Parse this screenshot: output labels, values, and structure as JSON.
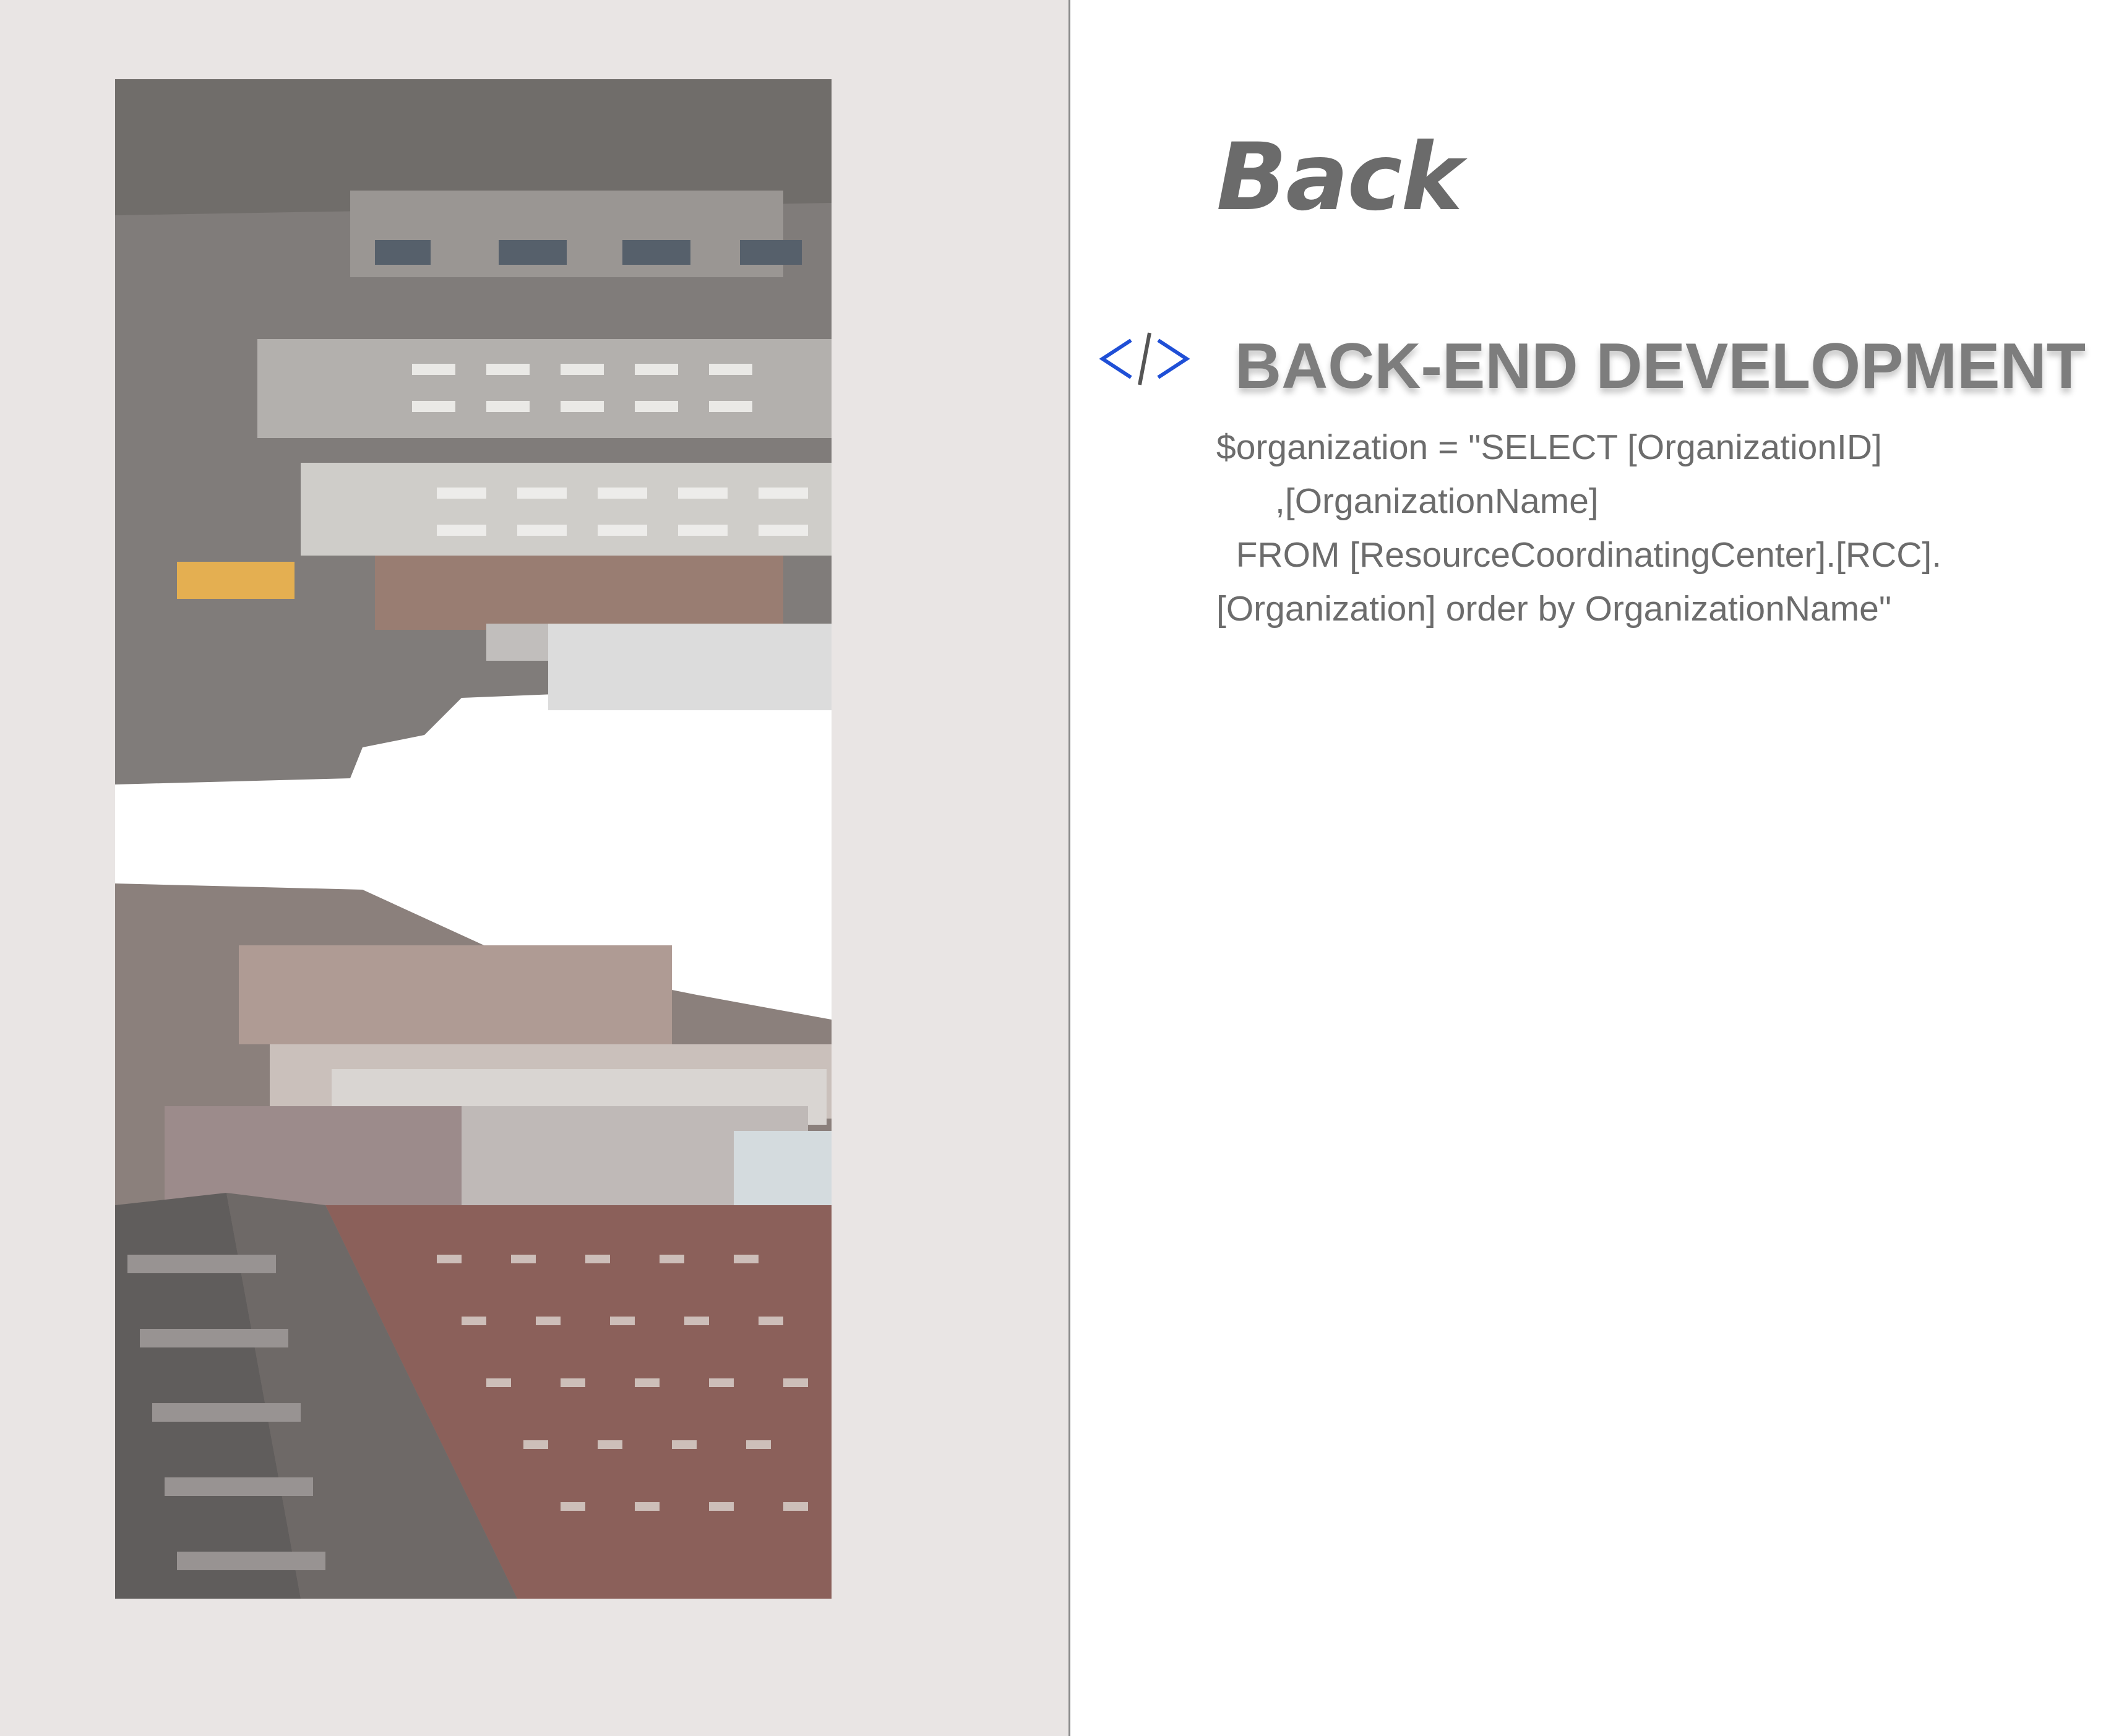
{
  "page": {
    "title": "Back",
    "section_icon": "code-brackets-icon",
    "section_heading": "BACK-END DEVELOPMENT",
    "code_lines": [
      "$organization = \"SELECT [OrganizationID]",
      "      ,[OrganizationName]",
      "  FROM [ResourceCoordinatingCenter].[RCC].",
      "[Organization] order by OrganizationName\""
    ]
  },
  "colors": {
    "left_panel_bg": "#e9e5e4",
    "title": "#6b6b6b",
    "heading": "#7d7d7d",
    "icon": "#1f4fd6",
    "body_text": "#6c6c6c"
  },
  "image": {
    "subject": "city-street-buildings-photo"
  }
}
